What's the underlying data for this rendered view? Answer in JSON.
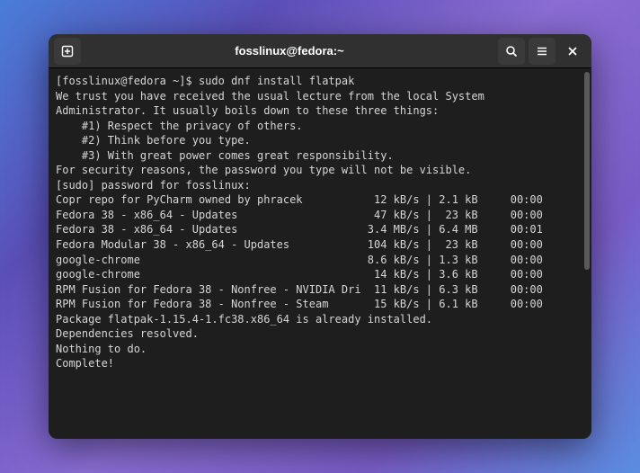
{
  "window": {
    "title": "fosslinux@fedora:~"
  },
  "terminal": {
    "lines": [
      "[fosslinux@fedora ~]$ sudo dnf install flatpak",
      "",
      "We trust you have received the usual lecture from the local System",
      "Administrator. It usually boils down to these three things:",
      "",
      "    #1) Respect the privacy of others.",
      "    #2) Think before you type.",
      "    #3) With great power comes great responsibility.",
      "",
      "For security reasons, the password you type will not be visible.",
      "",
      "[sudo] password for fosslinux:",
      "Copr repo for PyCharm owned by phracek           12 kB/s | 2.1 kB     00:00",
      "Fedora 38 - x86_64 - Updates                     47 kB/s |  23 kB     00:00",
      "Fedora 38 - x86_64 - Updates                    3.4 MB/s | 6.4 MB     00:01",
      "Fedora Modular 38 - x86_64 - Updates            104 kB/s |  23 kB     00:00",
      "google-chrome                                   8.6 kB/s | 1.3 kB     00:00",
      "google-chrome                                    14 kB/s | 3.6 kB     00:00",
      "RPM Fusion for Fedora 38 - Nonfree - NVIDIA Dri  11 kB/s | 6.3 kB     00:00",
      "RPM Fusion for Fedora 38 - Nonfree - Steam       15 kB/s | 6.1 kB     00:00",
      "Package flatpak-1.15.4-1.fc38.x86_64 is already installed.",
      "Dependencies resolved.",
      "Nothing to do.",
      "Complete!"
    ]
  }
}
